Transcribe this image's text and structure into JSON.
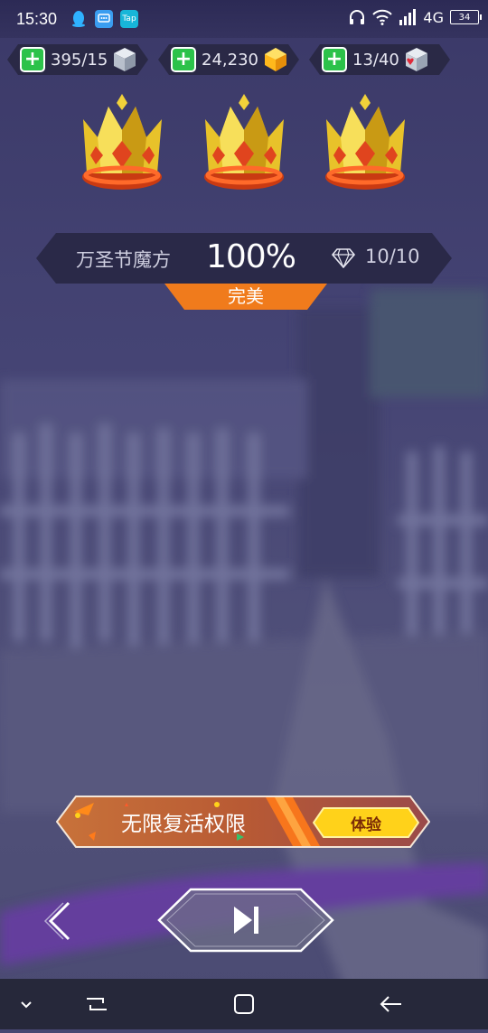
{
  "status_bar": {
    "time": "15:30",
    "app_icons": [
      "qq-icon",
      "message-icon",
      "taptap-icon"
    ],
    "taptap_label": "Tap",
    "network": "4G",
    "battery": "34"
  },
  "resources": [
    {
      "value": "395/15",
      "icon": "cube-icon"
    },
    {
      "value": "24,230",
      "icon": "gold-gem-icon"
    },
    {
      "value": "13/40",
      "icon": "heart-cube-icon"
    }
  ],
  "crowns": {
    "earned": 3,
    "total": 3
  },
  "result": {
    "level_name": "万圣节魔方",
    "percent": "100%",
    "gems": "10/10",
    "rating": "完美"
  },
  "promo": {
    "title": "无限复活权限",
    "button_label": "体验"
  },
  "colors": {
    "accent_orange": "#f07b1c",
    "plus_green": "#2cc24a",
    "promo_gold": "#ffd21a"
  }
}
